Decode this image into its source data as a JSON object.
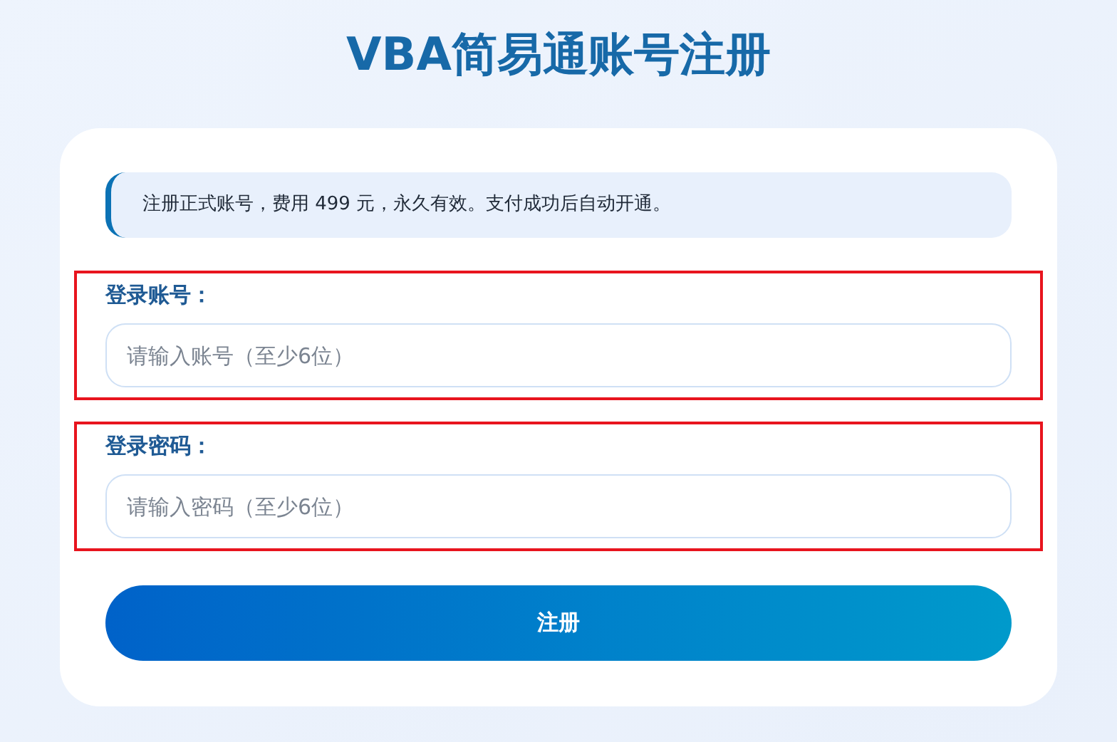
{
  "title": "VBA简易通账号注册",
  "notice": "注册正式账号，费用 499 元，永久有效。支付成功后自动开通。",
  "fields": [
    {
      "label": "登录账号：",
      "placeholder": "请输入账号（至少6位）",
      "highlighted": true
    },
    {
      "label": "登录密码：",
      "placeholder": "请输入密码（至少6位）",
      "highlighted": true
    }
  ],
  "button": "注册"
}
